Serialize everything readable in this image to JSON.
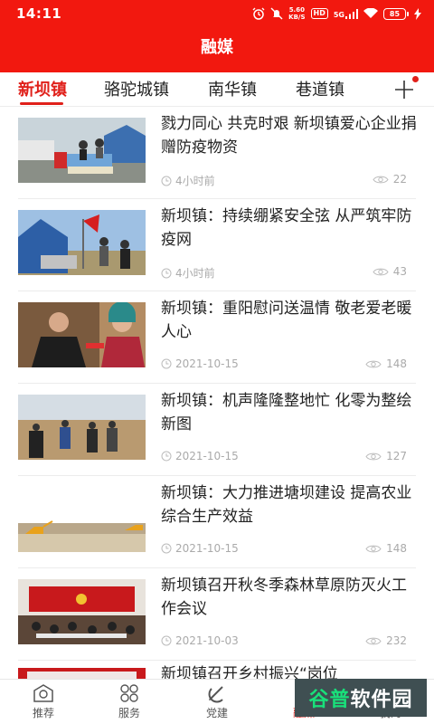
{
  "status_bar": {
    "time": "14:11",
    "net_speed": "5.60",
    "net_unit": "KB/S",
    "hd": "HD",
    "signal": "5G",
    "battery": "85"
  },
  "header": {
    "title": "融媒"
  },
  "tabs": [
    {
      "label": "新坝镇",
      "active": true
    },
    {
      "label": "骆驼城镇",
      "active": false
    },
    {
      "label": "南华镇",
      "active": false
    },
    {
      "label": "巷道镇",
      "active": false
    }
  ],
  "articles": [
    {
      "title": "戮力同心 共克时艰 新坝镇爱心企业捐赠防疫物资",
      "time": "4小时前",
      "views": "22"
    },
    {
      "title": "新坝镇：持续绷紧安全弦 从严筑牢防疫网",
      "time": "4小时前",
      "views": "43"
    },
    {
      "title": "新坝镇：重阳慰问送温情 敬老爱老暖人心",
      "time": "2021-10-15",
      "views": "148"
    },
    {
      "title": "新坝镇：机声隆隆整地忙 化零为整绘新图",
      "time": "2021-10-15",
      "views": "127"
    },
    {
      "title": "新坝镇：大力推进塘坝建设 提高农业综合生产效益",
      "time": "2021-10-15",
      "views": "148"
    },
    {
      "title": "新坝镇召开秋冬季森林草原防灭火工作会议",
      "time": "2021-10-03",
      "views": "232"
    },
    {
      "title": "新坝镇召开乡村振兴“岗位",
      "time": "",
      "views": ""
    }
  ],
  "bottom_nav": [
    {
      "label": "推荐",
      "icon": "recommend-icon"
    },
    {
      "label": "服务",
      "icon": "grid-icon"
    },
    {
      "label": "党建",
      "icon": "party-icon"
    },
    {
      "label": "融媒",
      "icon": "media-icon",
      "active": true
    },
    {
      "label": "我的",
      "icon": "user-icon"
    }
  ],
  "watermark": {
    "part1": "谷普",
    "part2": "软件园"
  },
  "colors": {
    "brand_red": "#f2180f",
    "active_tab": "#e0201a"
  }
}
